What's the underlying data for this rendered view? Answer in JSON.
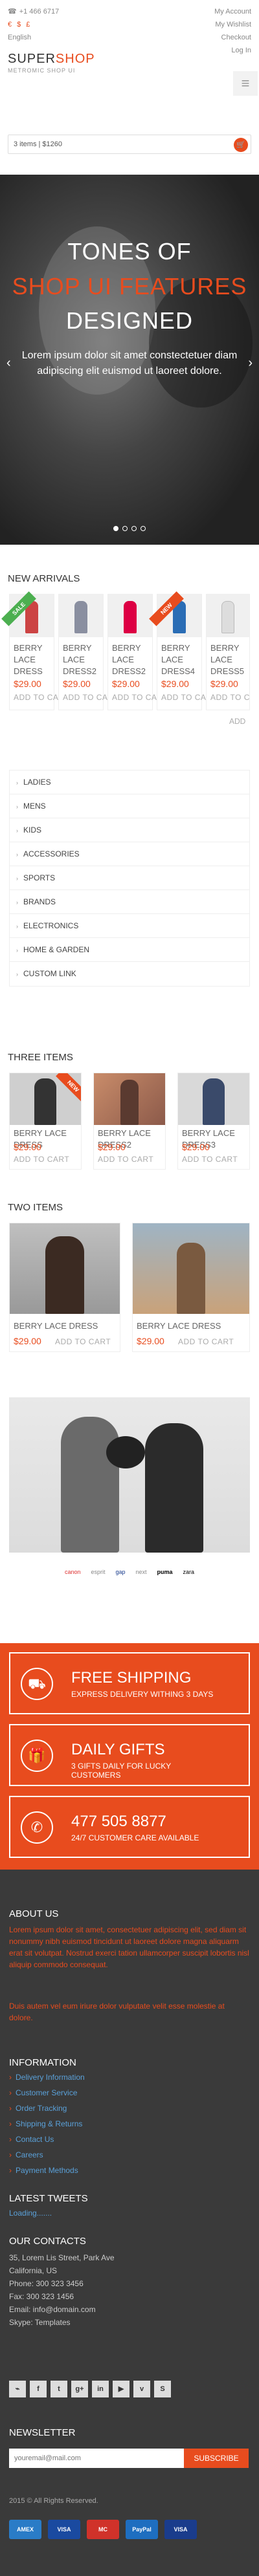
{
  "topbar": {
    "phone": "+1 466 6717",
    "currency_symbols": [
      "€",
      "$",
      "£"
    ],
    "language": "English",
    "account_links": [
      "My Account",
      "My Wishlist",
      "Checkout",
      "Log In"
    ]
  },
  "header": {
    "logo_main": "SUPER",
    "logo_accent": "SHOP",
    "logo_sub": "METROMIC SHOP UI",
    "cart_summary": "3 items | $1260"
  },
  "hero": {
    "line1": "TONES OF",
    "line2": "SHOP UI FEATURES",
    "line3": "DESIGNED",
    "text": "Lorem ipsum dolor sit amet constectetuer diam adipiscing elit euismod ut laoreet dolore."
  },
  "new_arrivals": {
    "title": "NEW ARRIVALS",
    "items": [
      {
        "name": "BERRY LACE DRESS",
        "price": "$29.00",
        "add": "ADD TO CART",
        "ribbon": "SALE"
      },
      {
        "name": "BERRY LACE DRESS2",
        "price": "$29.00",
        "add": "ADD TO CART",
        "ribbon": ""
      },
      {
        "name": "BERRY LACE DRESS2",
        "price": "$29.00",
        "add": "ADD TO CART",
        "ribbon": ""
      },
      {
        "name": "BERRY LACE DRESS4",
        "price": "$29.00",
        "add": "ADD TO CART",
        "ribbon": "NEW"
      },
      {
        "name": "BERRY LACE DRESS5",
        "price": "$29.00",
        "add": "ADD TO CART",
        "ribbon": ""
      }
    ],
    "trailing_add": "ADD"
  },
  "categories": [
    "LADIES",
    "MENS",
    "KIDS",
    "ACCESSORIES",
    "SPORTS",
    "BRANDS",
    "ELECTRONICS",
    "HOME & GARDEN",
    "CUSTOM LINK"
  ],
  "three_items": {
    "title": "THREE ITEMS",
    "items": [
      {
        "name": "BERRY LACE DRESS",
        "price": "$29.00",
        "add": "ADD TO CART",
        "ribbon": "NEW"
      },
      {
        "name": "BERRY LACE DRESS2",
        "price": "$29.00",
        "add": "ADD TO CART",
        "ribbon": ""
      },
      {
        "name": "BERRY LACE DRESS3",
        "price": "$29.00",
        "add": "ADD TO CART",
        "ribbon": ""
      }
    ]
  },
  "two_items": {
    "title": "TWO ITEMS",
    "items": [
      {
        "name": "BERRY LACE DRESS",
        "price": "$29.00",
        "add": "ADD TO CART"
      },
      {
        "name": "BERRY LACE DRESS",
        "price": "$29.00",
        "add": "ADD TO CART"
      }
    ]
  },
  "brands": [
    "canon",
    "esprit",
    "gap",
    "next",
    "puma",
    "zara"
  ],
  "features": [
    {
      "title": "FREE SHIPPING",
      "sub": "EXPRESS DELIVERY WITHING 3 DAYS",
      "icon": "truck-icon"
    },
    {
      "title": "DAILY GIFTS",
      "sub": "3 GIFTS DAILY FOR LUCKY CUSTOMERS",
      "icon": "gift-icon"
    },
    {
      "title": "477 505 8877",
      "sub": "24/7 CUSTOMER CARE AVAILABLE",
      "icon": "phone-icon"
    }
  ],
  "footer": {
    "about_title": "ABOUT US",
    "about_text1": "Lorem ipsum dolor sit amet, consectetuer adipiscing elit, sed diam sit nonummy nibh euismod tincidunt ut laoreet dolore magna aliquarm erat sit volutpat. Nostrud exerci tation ullamcorper suscipit lobortis nisl aliquip commodo consequat.",
    "about_text2": "Duis autem vel eum iriure dolor vulputate velit esse molestie at dolore.",
    "info_title": "INFORMATION",
    "info_links": [
      "Delivery Information",
      "Customer Service",
      "Order Tracking",
      "Shipping & Returns",
      "Contact Us",
      "Careers",
      "Payment Methods"
    ],
    "tweets_title": "LATEST TWEETS",
    "tweets_loading": "Loading.......",
    "contacts_title": "OUR CONTACTS",
    "contacts": [
      "35, Lorem Lis Street, Park Ave",
      "California, US",
      "Phone: 300 323 3456",
      "Fax: 300 323 1456",
      "Email: info@domain.com",
      "Skype: Templates"
    ],
    "social": [
      "rss",
      "facebook",
      "twitter",
      "google-plus",
      "linkedin",
      "youtube",
      "vimeo",
      "skype"
    ],
    "newsletter_title": "NEWSLETTER",
    "newsletter_placeholder": "youremail@mail.com",
    "subscribe": "SUBSCRIBE",
    "copyright": "2015 © All Rights Reserved.",
    "payments": [
      "AMEX",
      "VISA",
      "MC",
      "PayPal",
      "VISA"
    ]
  },
  "colors": {
    "accent": "#e84c1e",
    "footer_bg": "#3a3a3a"
  }
}
